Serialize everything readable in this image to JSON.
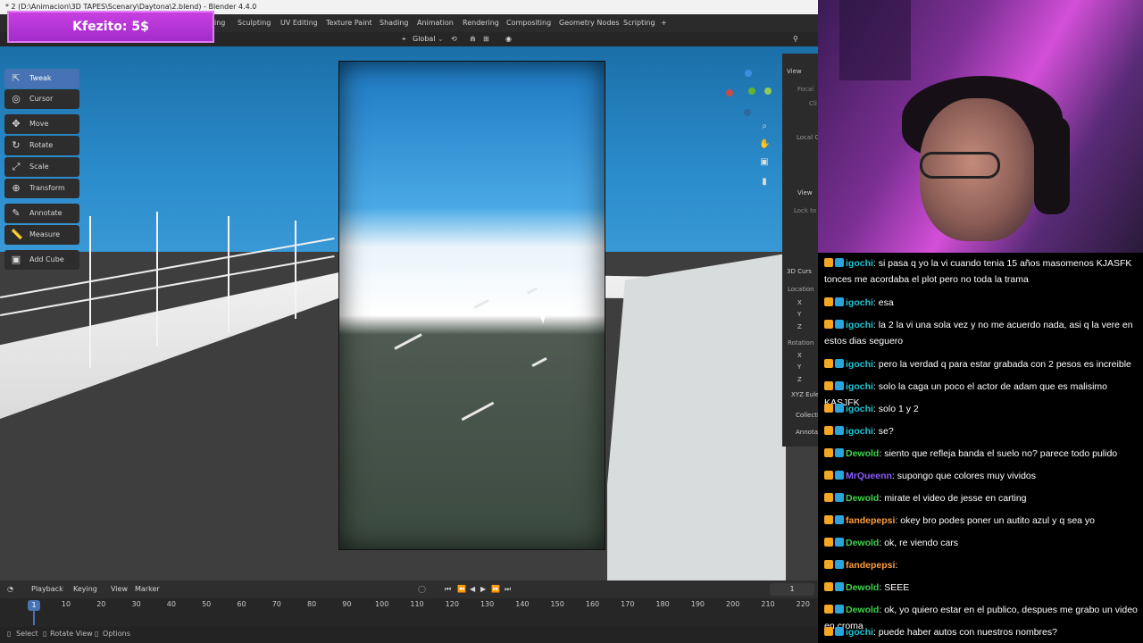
{
  "window": {
    "title": "* 2 (D:\\Animacion\\3D TAPES\\Scenary\\Daytona\\2.blend) - Blender 4.4.0"
  },
  "overlay": {
    "donation": "Kfezito: 5$"
  },
  "workspace_tabs": [
    "ing",
    "Sculpting",
    "UV Editing",
    "Texture Paint",
    "Shading",
    "Animation",
    "Rendering",
    "Compositing",
    "Geometry Nodes",
    "Scripting",
    "+"
  ],
  "viewport_header": {
    "orientation": "Global"
  },
  "tools": [
    {
      "label": "Tweak",
      "icon": "tweak-icon"
    },
    {
      "label": "Cursor",
      "icon": "cursor-icon"
    },
    {
      "label": "Move",
      "icon": "move-icon"
    },
    {
      "label": "Rotate",
      "icon": "rotate-icon"
    },
    {
      "label": "Scale",
      "icon": "scale-icon"
    },
    {
      "label": "Transform",
      "icon": "transform-icon"
    },
    {
      "label": "Annotate",
      "icon": "annotate-icon"
    },
    {
      "label": "Measure",
      "icon": "measure-icon"
    },
    {
      "label": "Add Cube",
      "icon": "add-cube-icon"
    }
  ],
  "npanel": {
    "view": "View",
    "focal": "Focal",
    "clip": "Cli",
    "local_c": "Local C",
    "view2": "View",
    "lock_to": "Lock to",
    "cursor": "3D Curs",
    "location": "Location",
    "x": "X",
    "y": "Y",
    "z": "Z",
    "rotation": "Rotation",
    "xyz_euler": "XYZ Eule",
    "collections": "Collecti",
    "annotations": "Annotat"
  },
  "timeline": {
    "menus": [
      "Playback",
      "Keying",
      "View",
      "Marker"
    ],
    "current_frame": "1",
    "frame_box": "1",
    "ticks": [
      "10",
      "20",
      "30",
      "40",
      "50",
      "60",
      "70",
      "80",
      "90",
      "100",
      "110",
      "120",
      "130",
      "140",
      "150",
      "160",
      "170",
      "180",
      "190",
      "200",
      "210",
      "220"
    ]
  },
  "statusbar": {
    "select": "Select",
    "rotate_view": "Rotate View",
    "options": "Options"
  },
  "chat": [
    {
      "user": "igochi",
      "color": "#1ec7d6",
      "text": "si pasa q yo la vi cuando tenia 15 años masomenos KJASFK tonces me acordaba el plot pero no toda la trama"
    },
    {
      "user": "igochi",
      "color": "#1ec7d6",
      "text": "esa"
    },
    {
      "user": "igochi",
      "color": "#1ec7d6",
      "text": "la 2 la vi una sola vez y no me acuerdo nada, asi q la vere en estos dias seguero"
    },
    {
      "user": "igochi",
      "color": "#1ec7d6",
      "text": "pero la verdad q para estar grabada con 2 pesos es increible"
    },
    {
      "user": "igochi",
      "color": "#1ec7d6",
      "text": "solo la caga un poco el actor de adam que es malisimo KASJFK"
    },
    {
      "user": "igochi",
      "color": "#1ec7d6",
      "text": "solo 1 y 2"
    },
    {
      "user": "igochi",
      "color": "#1ec7d6",
      "text": "se?"
    },
    {
      "user": "Dewold",
      "color": "#3fd24b",
      "text": "siento que refleja banda el suelo no? parece todo pulido"
    },
    {
      "user": "MrQueenn",
      "color": "#8a5cff",
      "text": "supongo que colores muy vividos"
    },
    {
      "user": "Dewold",
      "color": "#3fd24b",
      "text": "mirate el video de jesse en carting"
    },
    {
      "user": "fandepepsi",
      "color": "#ff9e3d",
      "text": "okey bro podes poner un autito azul y q sea yo"
    },
    {
      "user": "Dewold",
      "color": "#3fd24b",
      "text": "ok, re viendo cars"
    },
    {
      "user": "fandepepsi",
      "color": "#ff9e3d",
      "text": ""
    },
    {
      "user": "Dewold",
      "color": "#3fd24b",
      "text": "SEEE"
    },
    {
      "user": "Dewold",
      "color": "#3fd24b",
      "text": "ok, yo quiero estar en el publico, despues me grabo un video en croma"
    },
    {
      "user": "igochi",
      "color": "#1ec7d6",
      "text": "puede haber autos con nuestros nombres?"
    }
  ]
}
